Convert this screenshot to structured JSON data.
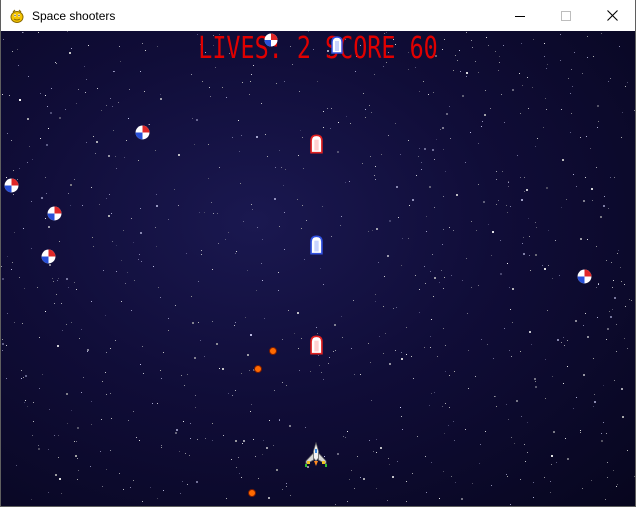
{
  "window": {
    "title": "Space shooters",
    "icon": "pygame-snake-icon",
    "controls": [
      "minimize-icon",
      "maximize-icon",
      "close-icon"
    ]
  },
  "hud": {
    "lives_label": "LIVES:",
    "lives": "2",
    "score_label": "SCORE",
    "score": "60",
    "color": "#e00000"
  },
  "colors": {
    "background": "#100d38",
    "laser_red": "#e02020",
    "laser_blue": "#3050e0",
    "enemy_bullet": "#ff6a00"
  },
  "sprites": {
    "player": "player-spaceship-icon",
    "enemy": "red-blue-orb-enemy-icon",
    "laser": "laser-bolt-icon",
    "bullet": "enemy-fireball-icon"
  }
}
